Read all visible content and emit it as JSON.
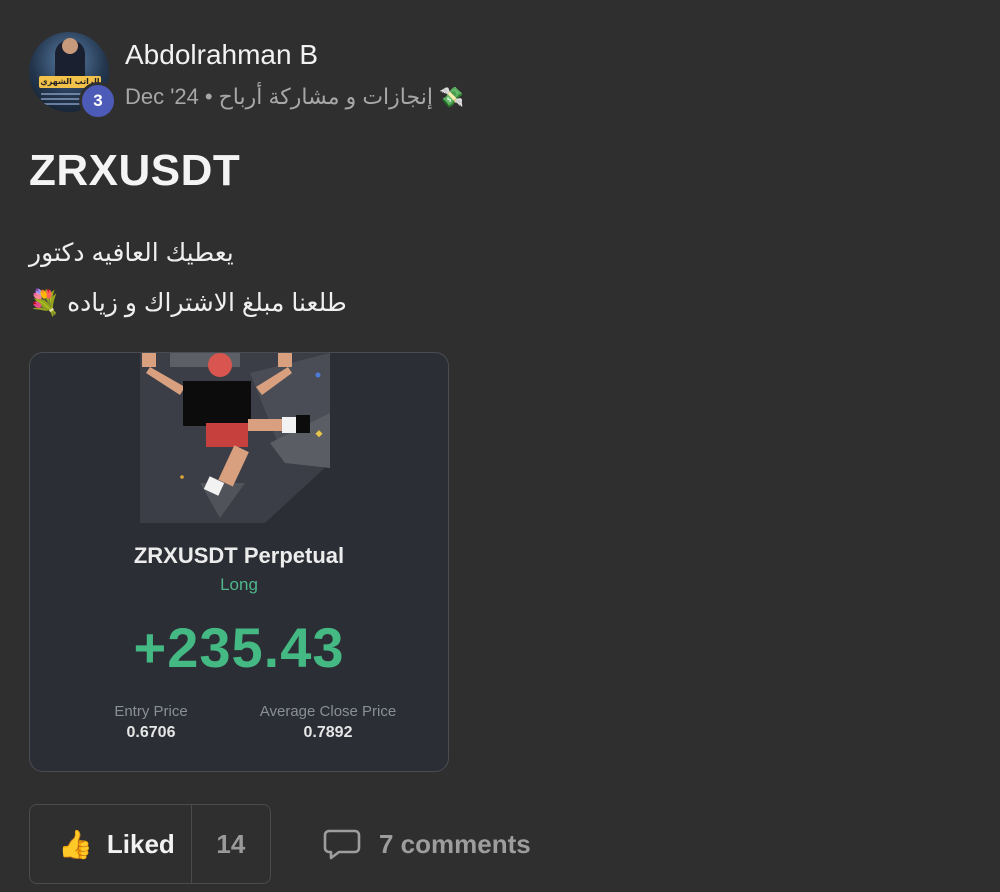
{
  "post": {
    "author": "Abdolrahman B",
    "avatar_badge": "3",
    "avatar_caption": "الراتب الشهري",
    "date": "Dec '24",
    "separator": "•",
    "category": "إنجازات و مشاركة أرباح",
    "category_icon": "money-wings-icon",
    "title": "ZRXUSDT",
    "body_lines": [
      "يعطيك العافيه دكتور",
      "طلعنا مبلغ الاشتراك و زياده 💐"
    ]
  },
  "trade_card": {
    "pair_label": "ZRXUSDT Perpetual",
    "side": "Long",
    "pnl": "+235.43",
    "entry_label": "Entry Price",
    "entry_value": "0.6706",
    "close_label": "Average Close Price",
    "close_value": "0.7892",
    "colors": {
      "profit": "#45b983",
      "card_bg": "#2b2e35"
    }
  },
  "actions": {
    "like_label": "Liked",
    "like_count": "14",
    "like_icon": "thumbs-up-icon",
    "comments_label": "7 comments",
    "comments_icon": "speech-bubble-icon"
  }
}
